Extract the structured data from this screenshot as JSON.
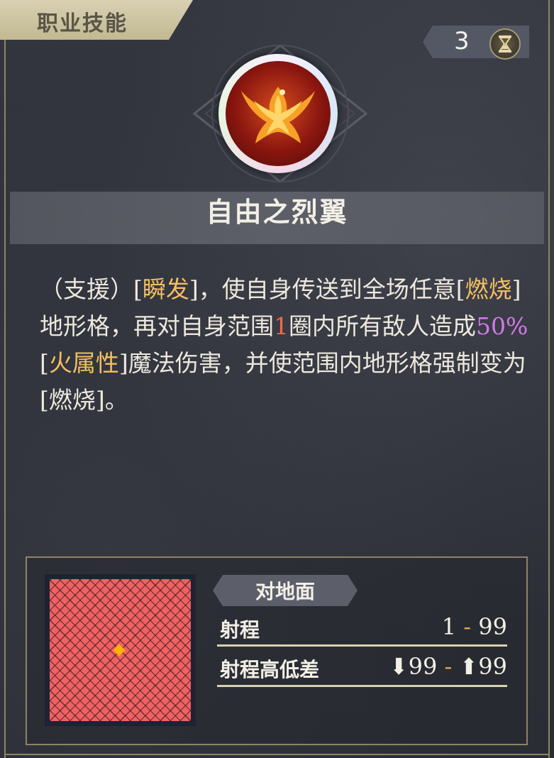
{
  "header": {
    "tab_title": "职业技能",
    "counter_value": "3",
    "counter_icon": "hourglass-icon"
  },
  "skill": {
    "icon": "phoenix-icon",
    "name": "自由之烈翼",
    "description": {
      "p1": "（支援）[",
      "k1": "瞬发",
      "p2": "]，使自身传送到全场任意[",
      "k2": "燃烧",
      "p3": "]地形格，再对自身范围",
      "num1": "1",
      "p4": "圈内所有敌人造成",
      "pct": "50%",
      "p5": "[",
      "k3": "火属性",
      "p6": "]魔法伤害，并使范围内地形格强制变为[燃烧]。"
    },
    "colors": {
      "keyword": "#f3bf63",
      "number": "#f46a4b",
      "percent": "#cf7be6"
    }
  },
  "info": {
    "target_label": "对地面",
    "range_label": "射程",
    "range_min": "1",
    "range_sep": "-",
    "range_max": "99",
    "height_label": "射程高低差",
    "height_down": "99",
    "height_sep": "-",
    "height_up": "99"
  },
  "grid": {
    "fill_color": "#f06262",
    "center_color": "#ffb300"
  }
}
